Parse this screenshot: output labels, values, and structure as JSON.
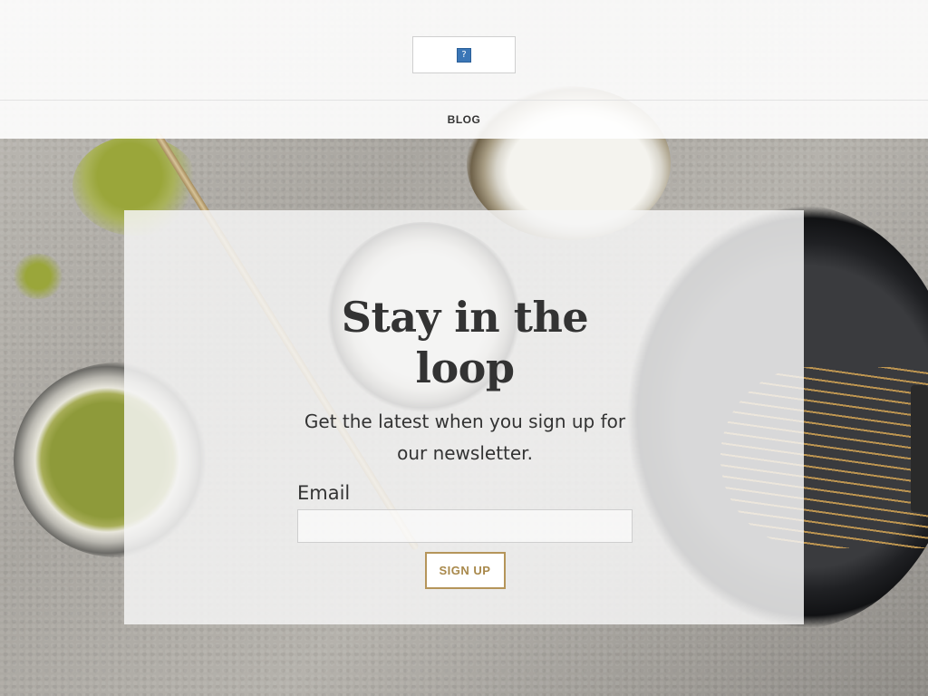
{
  "header": {
    "logo_icon": "broken-image-icon",
    "logo_glyph": "?"
  },
  "nav": {
    "items": [
      {
        "label": "BLOG"
      }
    ]
  },
  "newsletter": {
    "title": "Stay in the loop",
    "subtitle": "Get the latest when you sign up for our newsletter.",
    "email_label": "Email",
    "email_value": "",
    "email_placeholder": "",
    "button_label": "SIGN UP"
  },
  "colors": {
    "accent": "#b5955a",
    "text": "#333333",
    "card_bg": "#f5f5f5"
  }
}
